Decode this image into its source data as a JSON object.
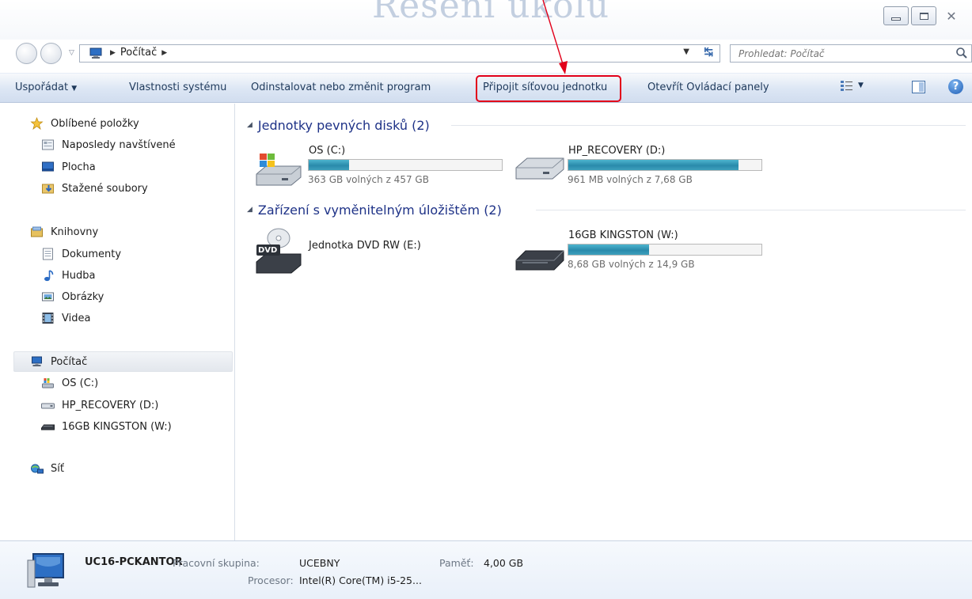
{
  "window": {
    "background_title": "Řešení úkolu",
    "controls": {
      "minimize": "minimize",
      "maximize": "maximize",
      "close": "✕"
    }
  },
  "address_bar": {
    "path": [
      "Počítač"
    ],
    "search_placeholder": "Prohledat: Počítač"
  },
  "toolbar": {
    "organize_label": "Uspořádat",
    "properties_label": "Vlastnosti systému",
    "uninstall_label": "Odinstalovat nebo změnit program",
    "map_drive_label": "Připojit síťovou jednotku",
    "control_panel_label": "Otevřít Ovládací panely",
    "help_label": "?",
    "highlight_color": "#e2001a"
  },
  "sidebar": {
    "favorites": {
      "label": "Oblíbené položky",
      "items": [
        "Naposledy navštívené",
        "Plocha",
        "Stažené soubory"
      ]
    },
    "libraries": {
      "label": "Knihovny",
      "items": [
        "Dokumenty",
        "Hudba",
        "Obrázky",
        "Videa"
      ]
    },
    "computer": {
      "label": "Počítač",
      "items": [
        "OS (C:)",
        "HP_RECOVERY (D:)",
        "16GB KINGSTON (W:)"
      ]
    },
    "network": {
      "label": "Síť"
    }
  },
  "main": {
    "hard_drives": {
      "title": "Jednotky pevných disků (2)",
      "drives": [
        {
          "name": "OS (C:)",
          "free_text": "363 GB volných z 457 GB",
          "used_fraction": 0.21
        },
        {
          "name": "HP_RECOVERY (D:)",
          "free_text": "961 MB volných z 7,68 GB",
          "used_fraction": 0.88
        }
      ]
    },
    "removable": {
      "title": "Zařízení s vyměnitelným úložištěm (2)",
      "devices": [
        {
          "name": "Jednotka DVD RW (E:)",
          "badge": "DVD"
        },
        {
          "name": "16GB KINGSTON (W:)",
          "free_text": "8,68 GB volných z 14,9 GB",
          "used_fraction": 0.42
        }
      ]
    }
  },
  "details": {
    "computer_name": "UC16-PCKANTOR",
    "workgroup_label": "Pracovní skupina:",
    "workgroup_value": "UCEBNY",
    "memory_label": "Paměť:",
    "memory_value": "4,00 GB",
    "processor_label": "Procesor:",
    "processor_value": "Intel(R) Core(TM) i5-25..."
  }
}
